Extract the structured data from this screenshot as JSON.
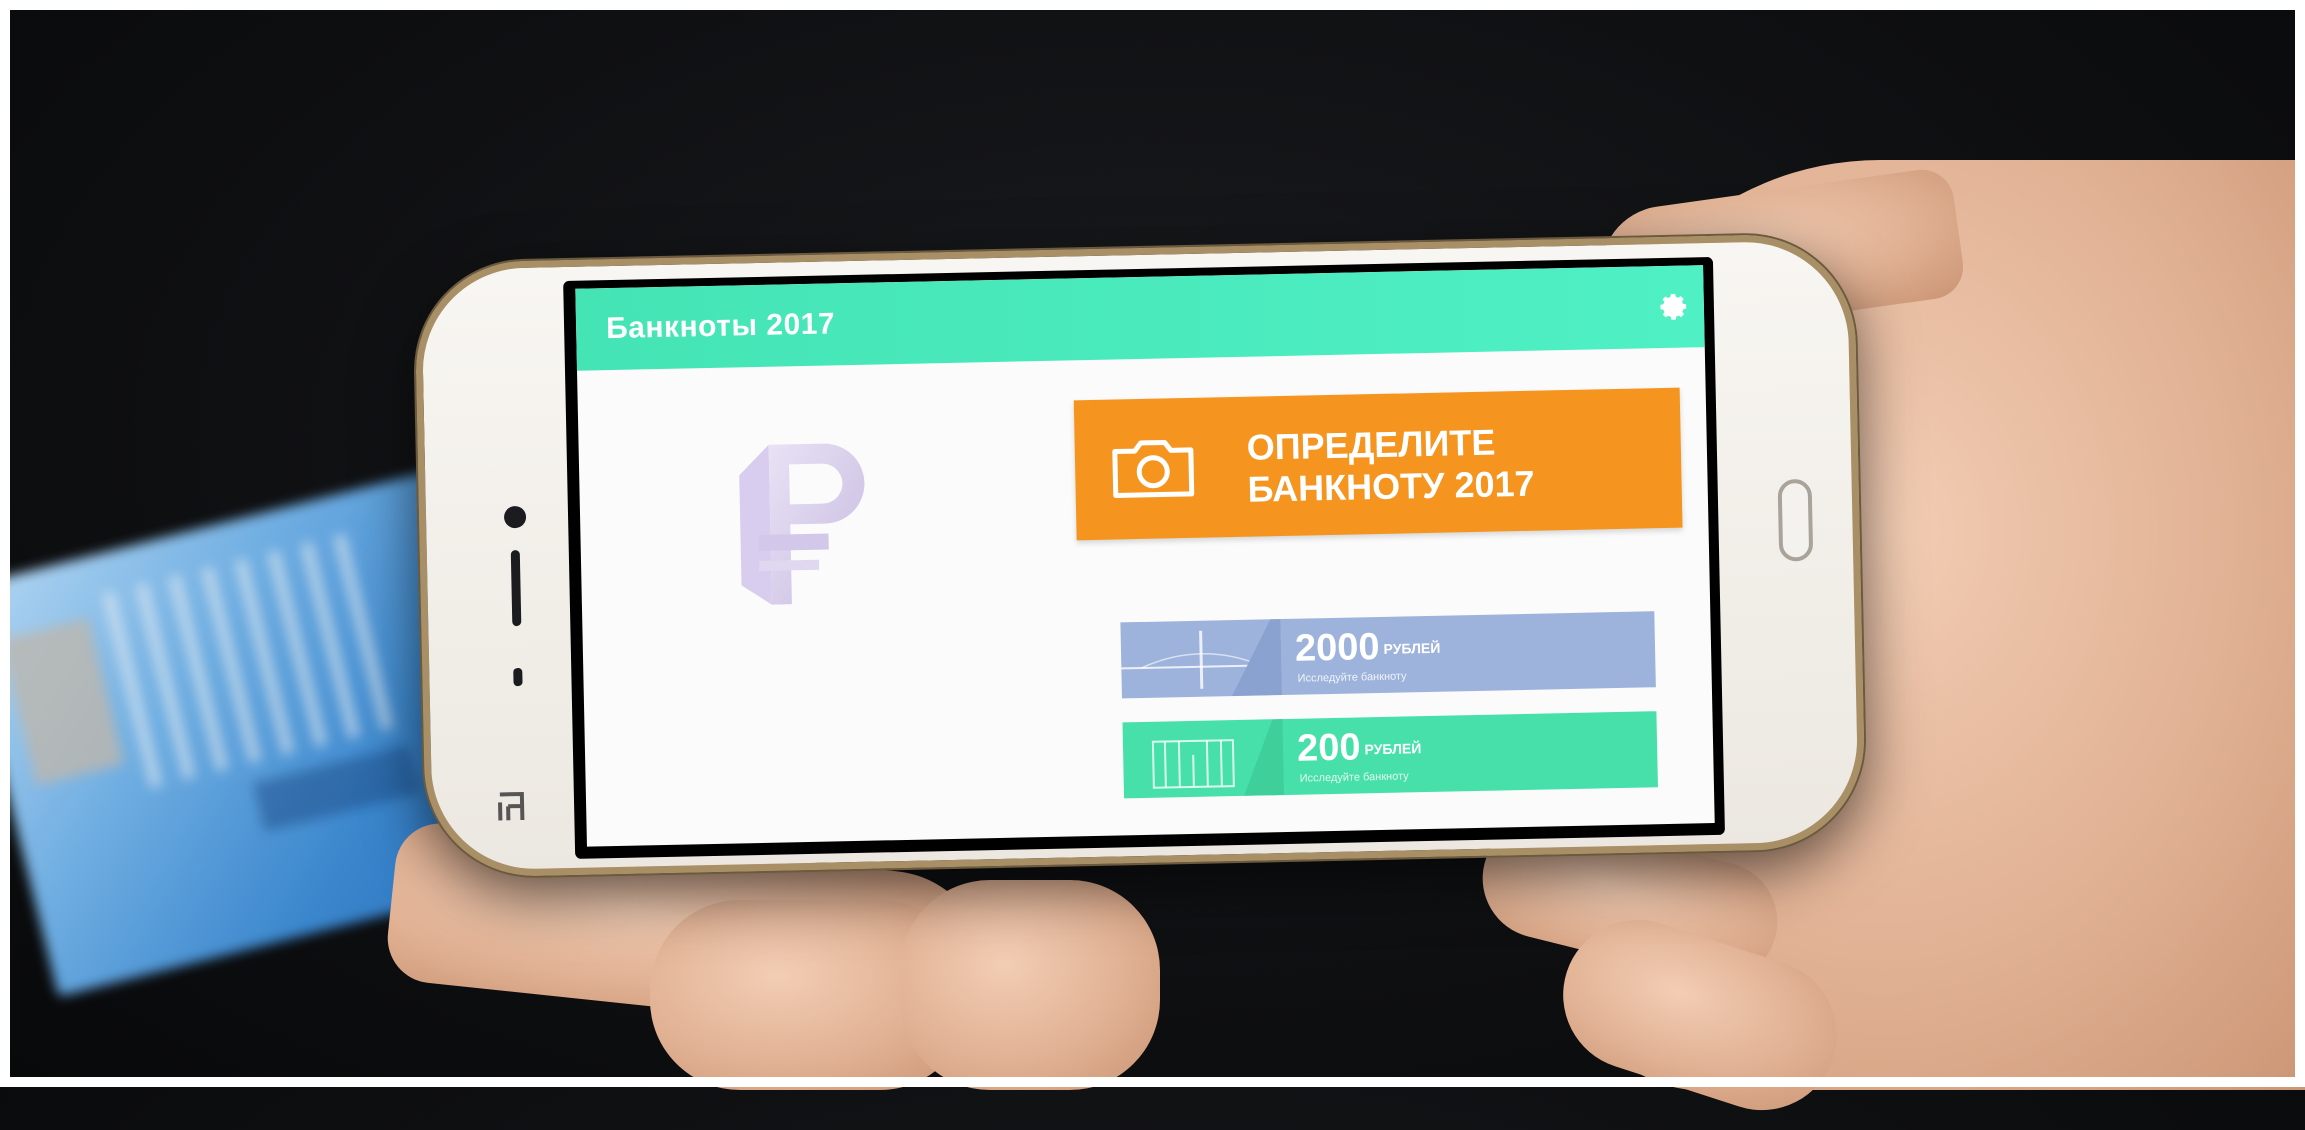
{
  "app": {
    "title": "Банкноты 2017",
    "settings_icon": "gear-icon",
    "accent_color": "#4ff0c4",
    "logo_icon": "ruble-icon"
  },
  "scan_button": {
    "line1": "ОПРЕДЕЛИТЕ",
    "line2": "БАНКНОТУ 2017",
    "icon": "camera-icon",
    "color": "#f5951f"
  },
  "notes": [
    {
      "amount": "2000",
      "unit": "РУБЛЕЙ",
      "subtitle": "Исследуйте банкноту",
      "color": "#9db3dc"
    },
    {
      "amount": "200",
      "unit": "РУБЛЕЙ",
      "subtitle": "Исследуйте банкноту",
      "color": "#47e0aa"
    }
  ]
}
